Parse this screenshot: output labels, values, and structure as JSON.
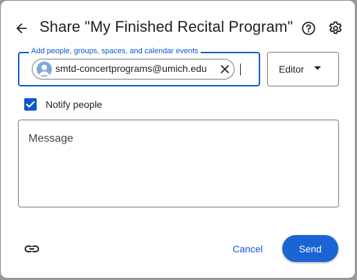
{
  "dialog": {
    "title": "Share \"My Finished Recital Program\""
  },
  "icons": {
    "back": "arrow-back-icon",
    "help": "help-circle-icon",
    "settings": "gear-icon",
    "remove_chip": "close-icon",
    "copy_link": "link-icon",
    "checkbox": "checkmark-icon"
  },
  "add_people": {
    "label": "Add people, groups, spaces, and calendar events",
    "chips": [
      {
        "email": "smtd-concertprograms@umich.edu"
      }
    ]
  },
  "role": {
    "selected": "Editor"
  },
  "notify": {
    "label": "Notify people",
    "checked": true
  },
  "message": {
    "placeholder": "Message"
  },
  "footer": {
    "cancel_label": "Cancel",
    "send_label": "Send"
  },
  "colors": {
    "accent": "#0b57d0",
    "send_button": "#1a64d6",
    "text": "#1f1f1f"
  }
}
